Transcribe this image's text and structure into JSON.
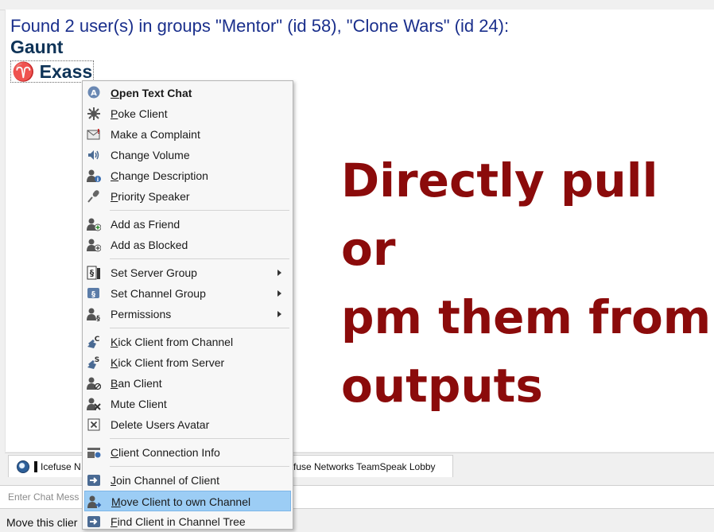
{
  "chat": {
    "found_text": "Found 2 user(s) in groups \"Mentor\" (id 58), \"Clone Wars\" (id 24):",
    "users": [
      {
        "name": "Gaunt"
      },
      {
        "name": "Exass",
        "symbol": "♈"
      }
    ]
  },
  "overlay": {
    "line1": "Directly pull or",
    "line2": "pm them from",
    "line3": "outputs",
    "color": "#8b0b0b"
  },
  "tabs": [
    {
      "label": "Icefuse N"
    },
    {
      "label": "fuse Networks TeamSpeak Lobby"
    }
  ],
  "input": {
    "placeholder": "Enter Chat Mess"
  },
  "status": {
    "text": "Move this clier"
  },
  "menu": {
    "items": [
      {
        "u": "O",
        "rest": "pen Text Chat",
        "icon": "text-chat-icon"
      },
      {
        "u": "P",
        "rest": "oke Client",
        "icon": "poke-icon"
      },
      {
        "u": "",
        "rest": "Make a Complaint",
        "icon": "complaint-icon"
      },
      {
        "u": "",
        "rest": "Change Volume",
        "icon": "volume-icon"
      },
      {
        "u": "C",
        "rest": "hange Description",
        "icon": "description-icon"
      },
      {
        "u": "P",
        "rest": "riority Speaker",
        "icon": "microphone-icon"
      },
      {
        "u": "",
        "rest": "Add as Friend",
        "icon": "add-friend-icon"
      },
      {
        "u": "",
        "rest": "Add as Blocked",
        "icon": "add-blocked-icon"
      },
      {
        "u": "",
        "rest": "Set Server Group",
        "icon": "server-group-icon"
      },
      {
        "u": "",
        "rest": "Set Channel Group",
        "icon": "channel-group-icon"
      },
      {
        "u": "",
        "rest": "Permissions",
        "icon": "permissions-icon"
      },
      {
        "u": "K",
        "rest": "ick Client from Channel",
        "icon": "kick-channel-icon"
      },
      {
        "u": "K",
        "rest": "ick Client from Server",
        "icon": "kick-server-icon"
      },
      {
        "u": "B",
        "rest": "an Client",
        "icon": "ban-icon"
      },
      {
        "u": "",
        "rest": "Mute Client",
        "icon": "mute-icon"
      },
      {
        "u": "",
        "rest": "Delete Users Avatar",
        "icon": "delete-avatar-icon"
      },
      {
        "u": "C",
        "rest": "lient Connection Info",
        "icon": "connection-info-icon"
      },
      {
        "u": "J",
        "rest": "oin Channel of Client",
        "icon": "join-channel-icon"
      },
      {
        "u": "M",
        "rest": "ove Client to own Channel",
        "icon": "move-client-icon"
      },
      {
        "u": "F",
        "rest": "ind Client in Channel Tree",
        "icon": "find-client-icon"
      }
    ],
    "highlight_color": "#9ccdf5"
  }
}
